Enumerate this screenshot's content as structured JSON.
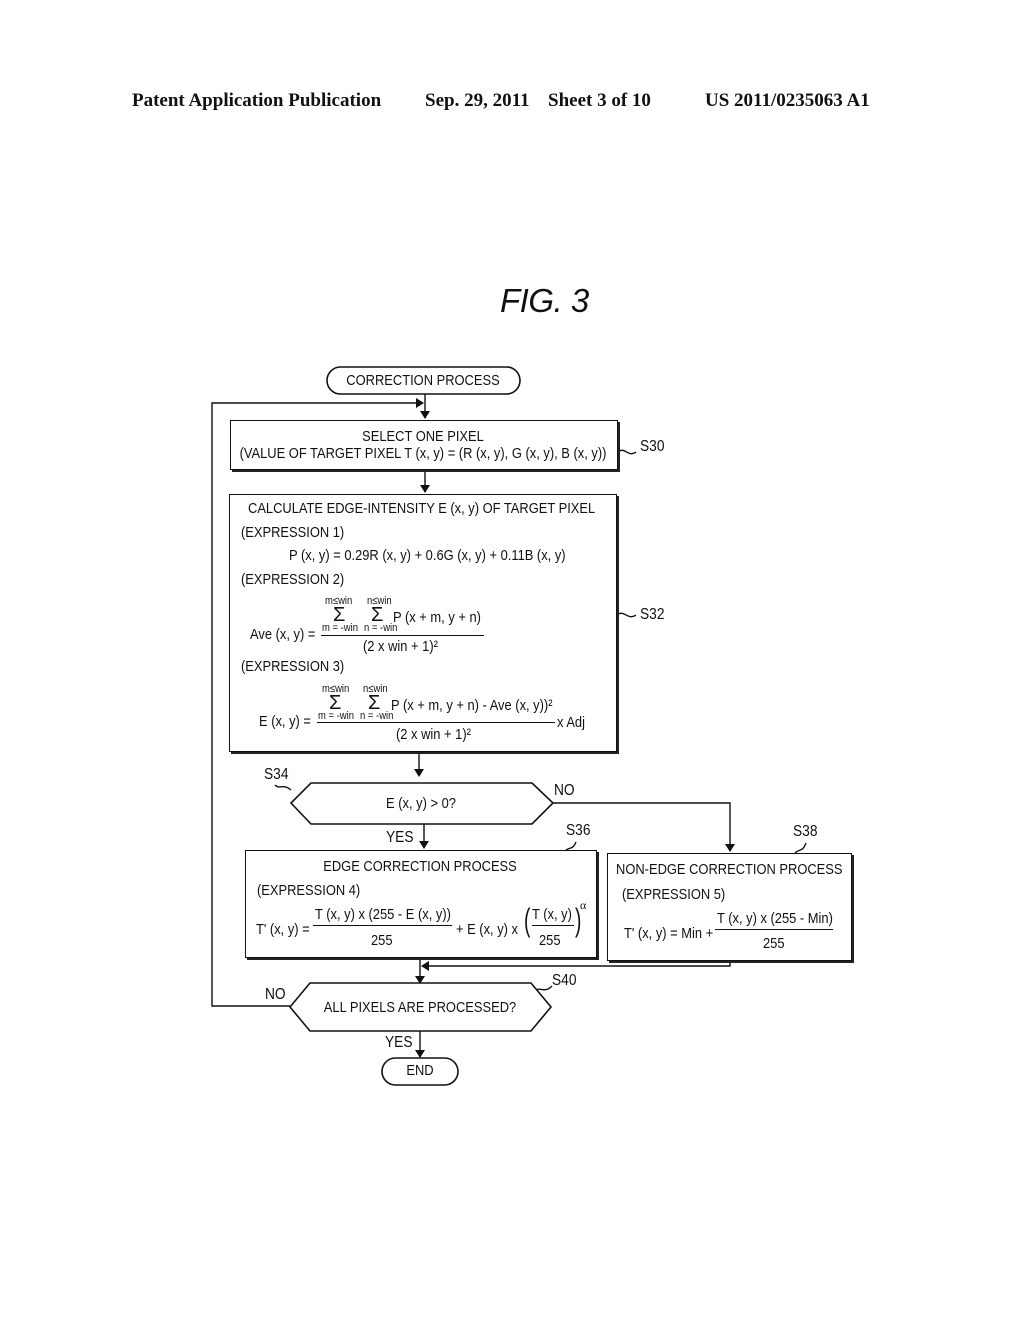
{
  "header": {
    "publication": "Patent Application Publication",
    "date": "Sep. 29, 2011",
    "sheet": "Sheet 3 of 10",
    "number": "US 2011/0235063 A1"
  },
  "figure_title": "FIG. 3",
  "start": {
    "label": "CORRECTION PROCESS"
  },
  "end": {
    "label": "END"
  },
  "s30": {
    "step": "S30",
    "line1": "SELECT ONE PIXEL",
    "line2": "(VALUE OF TARGET PIXEL T (x, y) = (R (x, y), G (x, y), B (x, y))"
  },
  "s32": {
    "step": "S32",
    "title": "CALCULATE EDGE-INTENSITY E (x, y) OF TARGET PIXEL",
    "expr1_label": "(EXPRESSION 1)",
    "expr1": "P (x, y) = 0.29R (x, y) + 0.6G (x, y) + 0.11B (x, y)",
    "expr2_label": "(EXPRESSION 2)",
    "expr2_lhs": "Ave (x, y) =",
    "expr2_num": "P (x + m, y + n)",
    "expr2_den": "(2 x win + 1)²",
    "expr3_label": "(EXPRESSION 3)",
    "expr3_lhs": "E (x, y) =",
    "expr3_num": "P (x + m, y + n) - Ave (x, y))²",
    "expr3_den": "(2 x win + 1)²",
    "expr3_tail": "x Adj",
    "sum_m_upper": "m≤win",
    "sum_m_lower": "m = -win",
    "sum_n_upper": "n≤win",
    "sum_n_lower": "n = -win",
    "sigma": "Σ"
  },
  "s34": {
    "step": "S34",
    "question": "E (x, y) > 0?",
    "yes": "YES",
    "no": "NO"
  },
  "s36": {
    "step": "S36",
    "title": "EDGE CORRECTION PROCESS",
    "expr_label": "(EXPRESSION 4)",
    "lhs": "T' (x, y) =",
    "num": "T (x, y) x (255 - E (x, y))",
    "den": "255",
    "mid": "+ E (x, y) x",
    "inner_num": "T (x, y)",
    "inner_den": "255",
    "exponent": "α"
  },
  "s38": {
    "step": "S38",
    "title": "NON-EDGE CORRECTION PROCESS",
    "expr_label": "(EXPRESSION 5)",
    "lhs": "T' (x, y) = Min +",
    "num": "T (x, y) x (255 - Min)",
    "den": "255"
  },
  "s40": {
    "step": "S40",
    "question": "ALL PIXELS ARE PROCESSED?",
    "yes": "YES",
    "no": "NO"
  }
}
